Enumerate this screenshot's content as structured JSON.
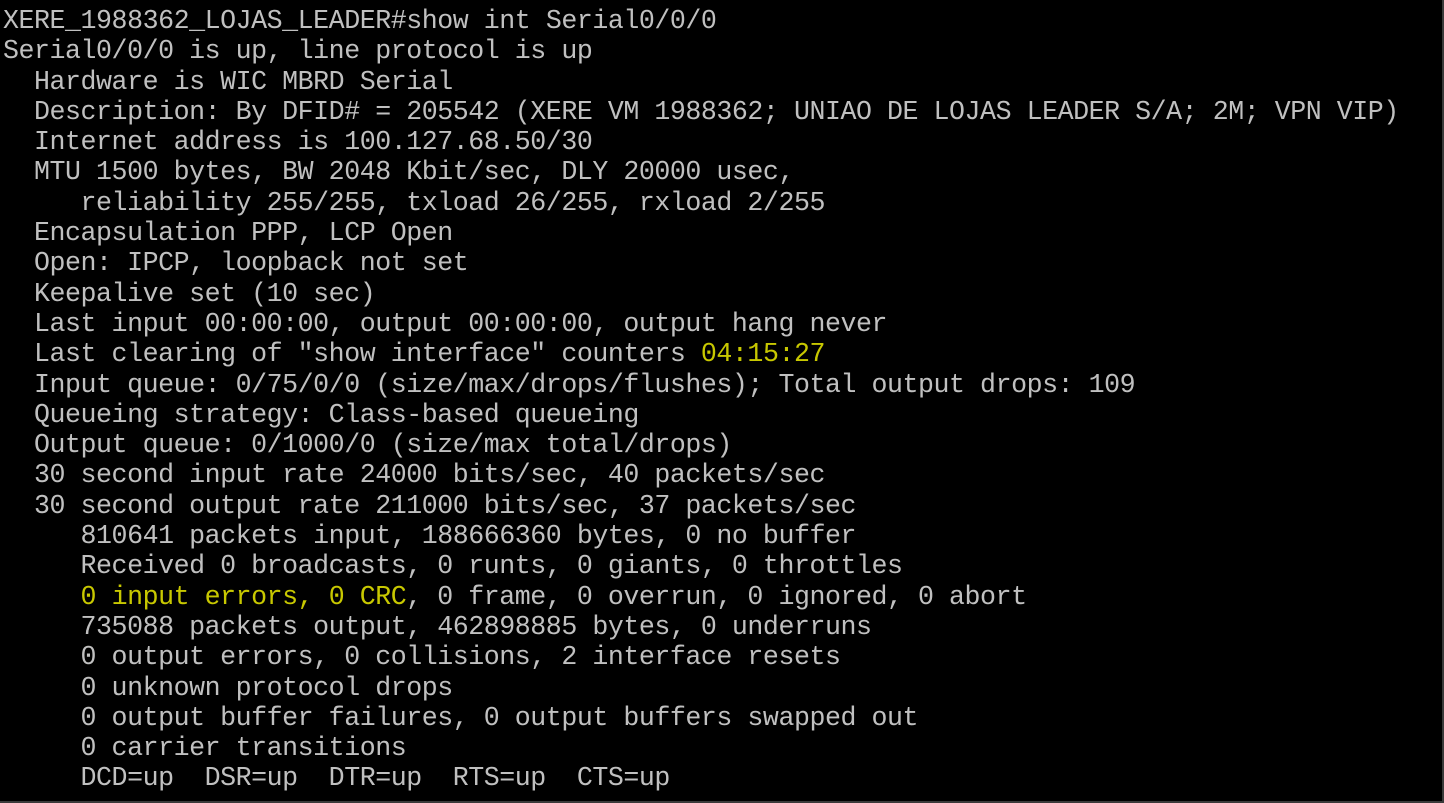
{
  "colors": {
    "background": "#000000",
    "text": "#c0c0c0",
    "highlight": "#c8c800"
  },
  "terminal": {
    "prompt": "XERE_1988362_LOJAS_LEADER#",
    "command": "show int Serial0/0/0",
    "lines": [
      "Serial0/0/0 is up, line protocol is up",
      "  Hardware is WIC MBRD Serial",
      "  Description: By DFID# = 205542 (XERE VM 1988362; UNIAO DE LOJAS LEADER S/A; 2M; VPN VIP)",
      "  Internet address is 100.127.68.50/30",
      "  MTU 1500 bytes, BW 2048 Kbit/sec, DLY 20000 usec,",
      "     reliability 255/255, txload 26/255, rxload 2/255",
      "  Encapsulation PPP, LCP Open",
      "  Open: IPCP, loopback not set",
      "  Keepalive set (10 sec)",
      "  Last input 00:00:00, output 00:00:00, output hang never"
    ],
    "last_clearing_prefix": "  Last clearing of \"show interface\" counters ",
    "last_clearing_time": "04:15:27",
    "lines_after_clearing": [
      "  Input queue: 0/75/0/0 (size/max/drops/flushes); Total output drops: 109",
      "  Queueing strategy: Class-based queueing",
      "  Output queue: 0/1000/0 (size/max total/drops)",
      "  30 second input rate 24000 bits/sec, 40 packets/sec",
      "  30 second output rate 211000 bits/sec, 37 packets/sec",
      "     810641 packets input, 188666360 bytes, 0 no buffer",
      "     Received 0 broadcasts, 0 runts, 0 giants, 0 throttles"
    ],
    "input_errors_indent": "     ",
    "input_errors_highlight": "0 input errors, 0 CRC",
    "input_errors_rest": ", 0 frame, 0 overrun, 0 ignored, 0 abort",
    "lines_tail": [
      "     735088 packets output, 462898885 bytes, 0 underruns",
      "     0 output errors, 0 collisions, 2 interface resets",
      "     0 unknown protocol drops",
      "     0 output buffer failures, 0 output buffers swapped out",
      "     0 carrier transitions",
      "     DCD=up  DSR=up  DTR=up  RTS=up  CTS=up"
    ]
  }
}
